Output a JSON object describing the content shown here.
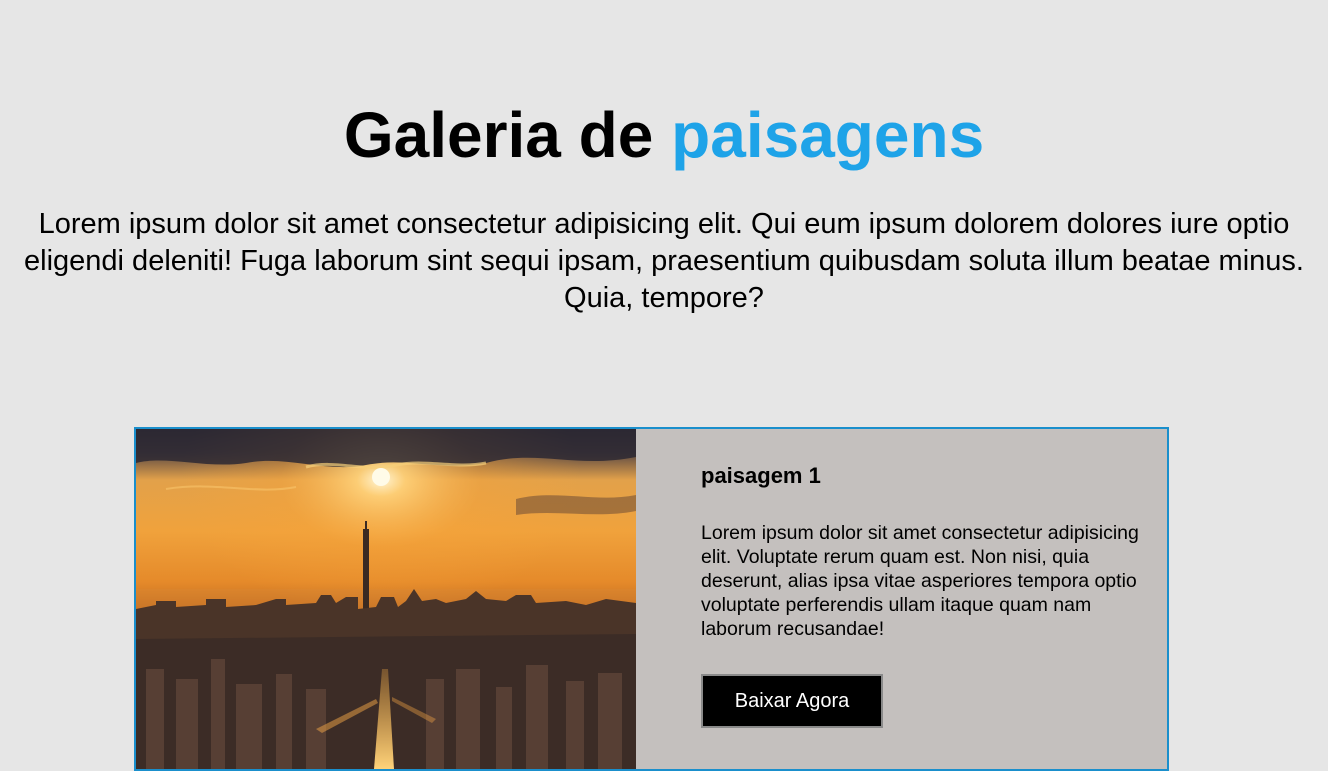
{
  "header": {
    "title_prefix": "Galeria de",
    "title_accent": "paisagens",
    "accent_color": "#1ea3e8",
    "intro": "Lorem ipsum dolor sit amet consectetur adipisicing elit. Qui eum ipsum dolorem dolores iure optio eligendi deleniti! Fuga laborum sint sequi ipsam, praesentium quibusdam soluta illum beatae minus. Quia, tempore?"
  },
  "cards": [
    {
      "title": "paisagem 1",
      "text": "Lorem ipsum dolor sit amet consectetur adipisicing elit. Voluptate rerum quam est. Non nisi, quia deserunt, alias ipsa vitae asperiores tempora optio voluptate perferendis ullam itaque quam nam laborum recusandae!",
      "button_label": "Baixar Agora"
    }
  ]
}
